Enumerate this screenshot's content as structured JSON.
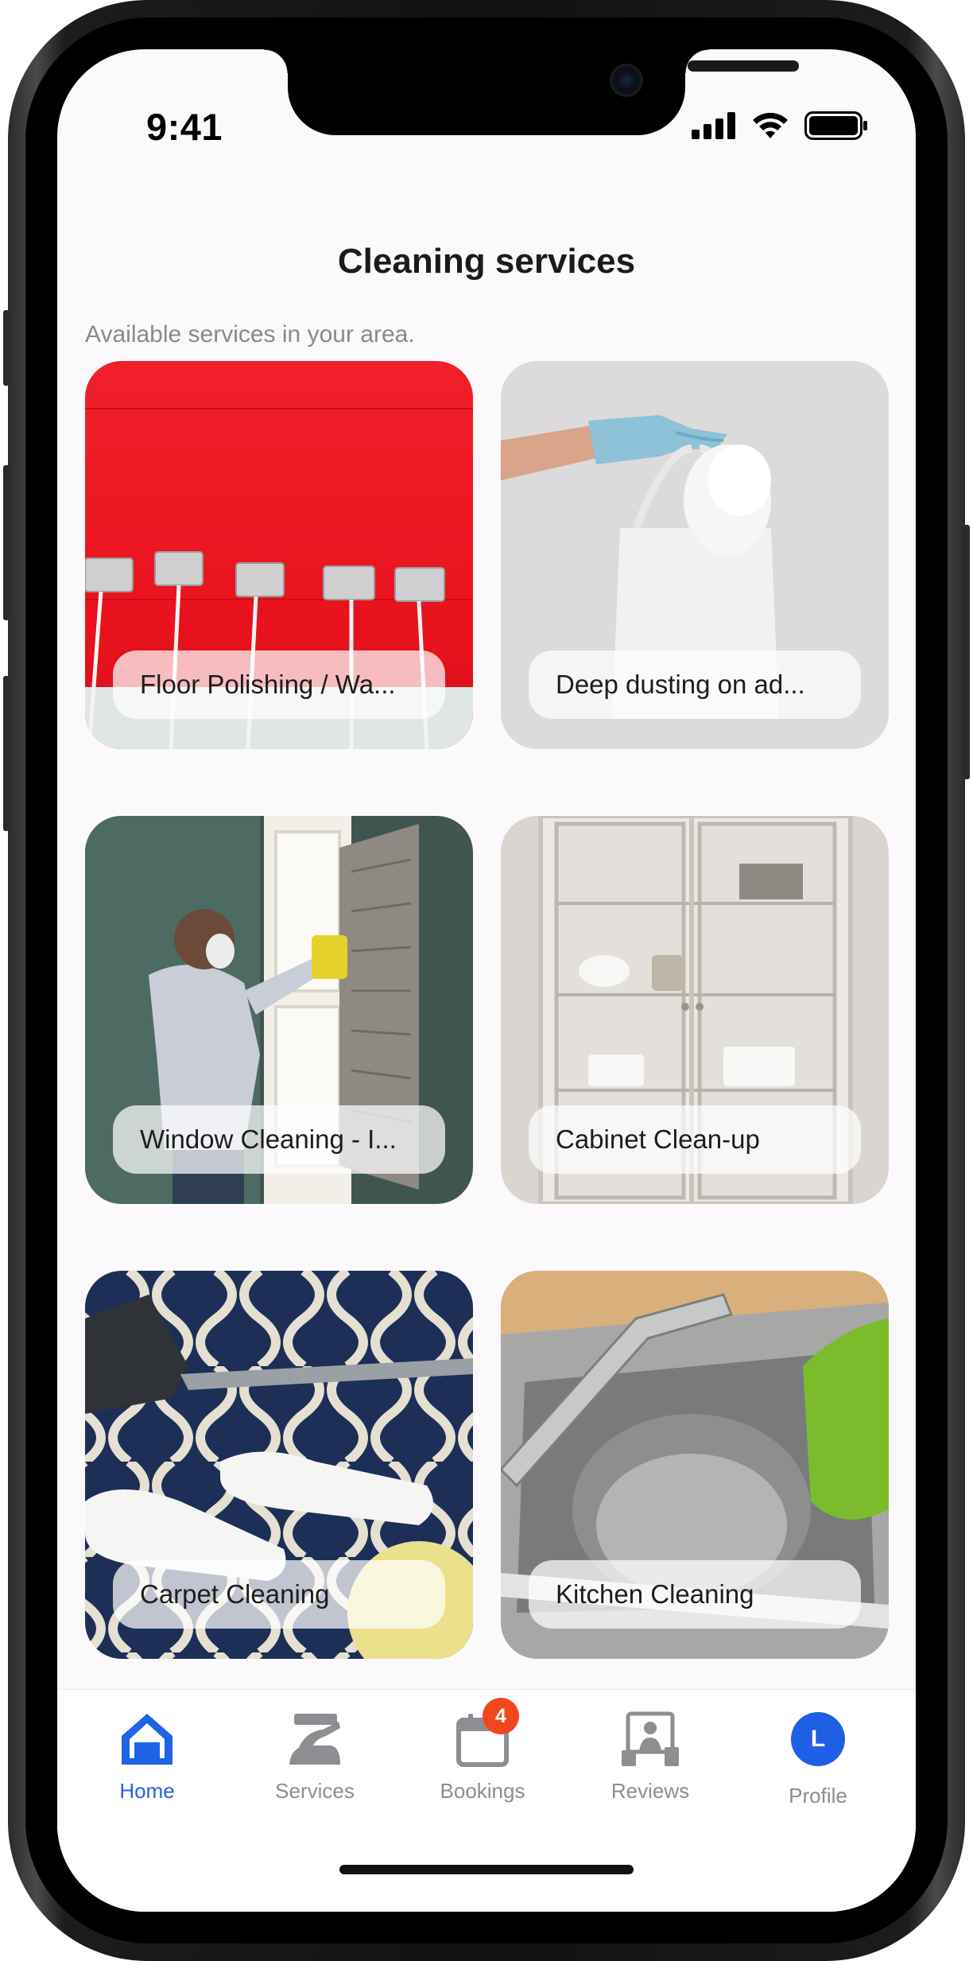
{
  "status_bar": {
    "time": "9:41"
  },
  "header": {
    "title": "Cleaning services",
    "subtitle": "Available services in your area."
  },
  "services": [
    {
      "label": "Floor Polishing / Wa...",
      "image": "red-wall-mops"
    },
    {
      "label": "Deep dusting on ad...",
      "image": "gloved-hand-duster-bag"
    },
    {
      "label": "Window Cleaning - I...",
      "image": "person-cleaning-window"
    },
    {
      "label": "Cabinet Clean-up",
      "image": "white-glass-cabinet"
    },
    {
      "label": "Carpet Cleaning",
      "image": "vacuum-on-patterned-carpet"
    },
    {
      "label": "Kitchen Cleaning",
      "image": "steel-kitchen-sink"
    }
  ],
  "tabbar": {
    "tabs": [
      {
        "label": "Home",
        "icon": "home-icon",
        "active": true
      },
      {
        "label": "Services",
        "icon": "services-icon"
      },
      {
        "label": "Bookings",
        "icon": "calendar-icon",
        "badge": "4"
      },
      {
        "label": "Reviews",
        "icon": "reviews-icon"
      },
      {
        "label": "Profile",
        "icon": "avatar",
        "avatar_initial": "L"
      }
    ]
  },
  "colors": {
    "accent": "#1f63e6",
    "badge": "#f1471d",
    "screen_background": "#fbf9fc",
    "inactive_tab": "#8d8d92"
  }
}
